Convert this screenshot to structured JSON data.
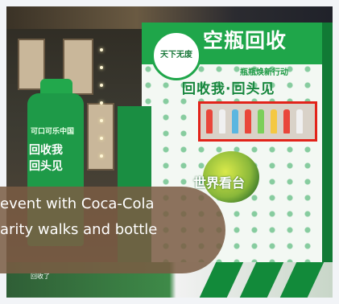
{
  "booth": {
    "title_sign": "空瓶回收",
    "slogan_top": "瓶瓶焕新行动",
    "slogan_main": "回收我·回头见",
    "world_text": "世界看台",
    "logo_text": "天下无废"
  },
  "tower": {
    "line1": "可口可乐中国",
    "line2": "回收我",
    "line3": "回头见"
  },
  "bin": {
    "label": "回收了"
  },
  "caption": {
    "line1": "event with Coca-Cola",
    "line2": "arity walks and bottle"
  },
  "colors": {
    "brand_green": "#1fa64a",
    "caption_bg": "#7a5c44",
    "window_frame": "#e2231a"
  }
}
